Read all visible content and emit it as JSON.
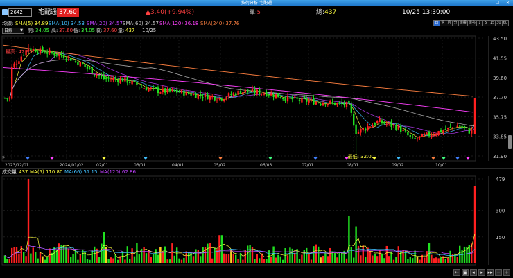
{
  "window": {
    "title": "技術分析-宅配通"
  },
  "header": {
    "code": "2642",
    "name": "宅配通",
    "price": "37.60",
    "change": "▲3.40(+9.94%)",
    "unit_label": "單:",
    "unit_value": "5",
    "total_label": "總:",
    "total_value": "437",
    "datetime": "10/25 13:30:00"
  },
  "ma_legend": {
    "label": "均線:",
    "items": [
      {
        "text": "SMA(5) 34.89",
        "color": "#ffff40"
      },
      {
        "text": "SMA(10) 34.53",
        "color": "#40c0ff"
      },
      {
        "text": "SMA(20) 34.57",
        "color": "#c040ff"
      },
      {
        "text": "SMA(60) 34.57",
        "color": "#c8c8c8"
      },
      {
        "text": "SMA(120) 36.18",
        "color": "#ff40ff"
      },
      {
        "text": "SMA(240) 37.76",
        "color": "#ff8040"
      }
    ]
  },
  "interval": "日線",
  "ohlc": {
    "open_label": "開:",
    "open": "34.05",
    "high_label": "高:",
    "high": "37.60",
    "low_label": "低:",
    "low": "34.05",
    "close_label": "收:",
    "close": "37.60",
    "volume_label": "量:",
    "volume": "437",
    "date": "10/25"
  },
  "period_tabs": [
    "日",
    "週",
    "月",
    "分",
    "還權",
    "還亮",
    "1",
    "5",
    "15",
    "30",
    "60"
  ],
  "price_axis": [
    "43.50",
    "41.55",
    "39.60",
    "37.70",
    "35.75",
    "33.85",
    "31.90"
  ],
  "date_axis": [
    "2023/12/01",
    "2024/01/02",
    "02/01",
    "03/01",
    "04/01",
    "05/02",
    "06/03",
    "07/01",
    "08/01",
    "09/02",
    "10/01"
  ],
  "annotations": {
    "high": "最高: 42.95",
    "low": "最低: 32.00"
  },
  "vol_legend": {
    "label": "成交量",
    "value": "437",
    "items": [
      {
        "text": "MA(5) 110.80",
        "color": "#ffff40"
      },
      {
        "text": "MA(66) 51.15",
        "color": "#40c0ff"
      },
      {
        "text": "MA(120) 62.86",
        "color": "#c040ff"
      }
    ]
  },
  "vol_axis": [
    "479",
    "300",
    "150"
  ],
  "toolbar": [
    "←",
    "▣",
    "◂",
    "▸",
    "▸▸",
    "−",
    "+"
  ],
  "colors": {
    "up": "#ff2020",
    "down": "#20e020",
    "background": "#000000",
    "accent": "#2a6ad0"
  },
  "chart_data": [
    {
      "type": "candlestick",
      "title": "",
      "x_range": [
        "2023/12/01",
        "10/25"
      ],
      "ylim": [
        31.9,
        43.5
      ],
      "price_path": [
        [
          "2023/12/01",
          40.6
        ],
        [
          "2023/12/15",
          42.5
        ],
        [
          "2024/01/02",
          41.7
        ],
        [
          "2024/01/15",
          40.9
        ],
        [
          "02/01",
          39.5
        ],
        [
          "02/20",
          39.4
        ],
        [
          "03/01",
          38.7
        ],
        [
          "03/15",
          38.3
        ],
        [
          "04/01",
          38.2
        ],
        [
          "04/15",
          37.9
        ],
        [
          "05/02",
          37.6
        ],
        [
          "05/15",
          38.3
        ],
        [
          "06/03",
          38.1
        ],
        [
          "06/20",
          37.5
        ],
        [
          "07/01",
          37.3
        ],
        [
          "07/15",
          37.1
        ],
        [
          "07/28",
          36.9
        ],
        [
          "08/01",
          34.2
        ],
        [
          "08/15",
          35.3
        ],
        [
          "09/02",
          34.7
        ],
        [
          "09/10",
          33.5
        ],
        [
          "09/20",
          33.9
        ],
        [
          "10/01",
          34.4
        ],
        [
          "10/15",
          34.9
        ],
        [
          "10/24",
          34.2
        ],
        [
          "10/25",
          37.6
        ]
      ],
      "extremes": {
        "high": 42.95,
        "low": 32.0
      },
      "last_candle": {
        "open": 34.05,
        "high": 37.6,
        "low": 34.05,
        "close": 37.6
      }
    },
    {
      "type": "bar",
      "title": "成交量",
      "ylim": [
        0,
        479
      ],
      "peaks": [
        {
          "x": "2023/12/15",
          "value": 479
        },
        {
          "x": "02/01",
          "value": 180
        },
        {
          "x": "05/02",
          "value": 160
        },
        {
          "x": "07/28",
          "value": 270
        },
        {
          "x": "08/01",
          "value": 210
        },
        {
          "x": "10/25",
          "value": 437
        }
      ],
      "typical_range": [
        20,
        120
      ]
    }
  ]
}
